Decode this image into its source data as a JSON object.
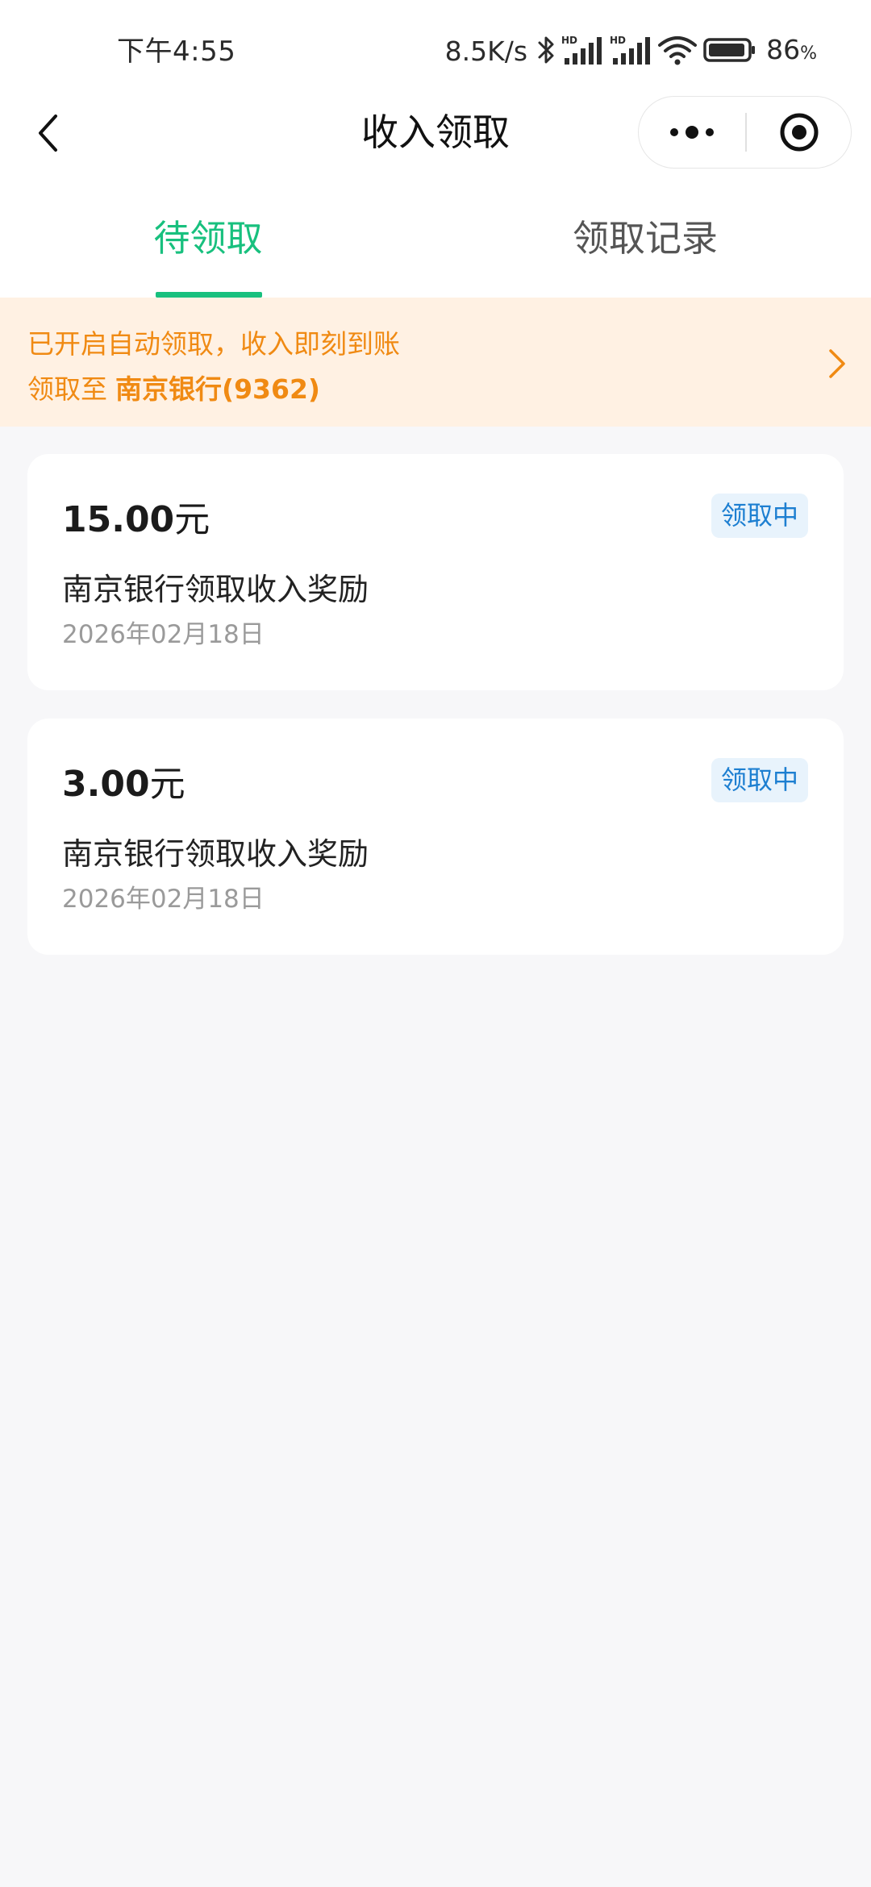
{
  "status_bar": {
    "time": "下午4:55",
    "network_speed": "8.5K/s",
    "battery_level": "86",
    "battery_unit": "%",
    "icons": [
      "bluetooth-icon",
      "signal-hd-icon",
      "signal-hd-icon",
      "wifi-icon",
      "battery-icon"
    ]
  },
  "nav": {
    "title": "收入领取",
    "back_icon": "chevron-left-icon",
    "more_icon": "more-dots-icon",
    "close_icon": "target-close-icon"
  },
  "tabs": [
    {
      "label": "待领取",
      "active": true
    },
    {
      "label": "领取记录",
      "active": false
    }
  ],
  "notice": {
    "line1": "已开启自动领取，收入即刻到账",
    "line2_prefix": "领取至",
    "line2_bank": "南京银行(9362)",
    "icon": "chevron-right-icon"
  },
  "records": [
    {
      "amount": "15.00",
      "unit": "元",
      "status": "领取中",
      "title": "南京银行领取收入奖励",
      "date": "2026年02月18日"
    },
    {
      "amount": "3.00",
      "unit": "元",
      "status": "领取中",
      "title": "南京银行领取收入奖励",
      "date": "2026年02月18日"
    }
  ],
  "colors": {
    "accent_green": "#18c07e",
    "notice_orange": "#f08a13",
    "notice_bg": "#fff1e3",
    "badge_blue": "#1d7fd1",
    "badge_bg": "#e8f3fc",
    "page_bg": "#f7f7f9"
  }
}
